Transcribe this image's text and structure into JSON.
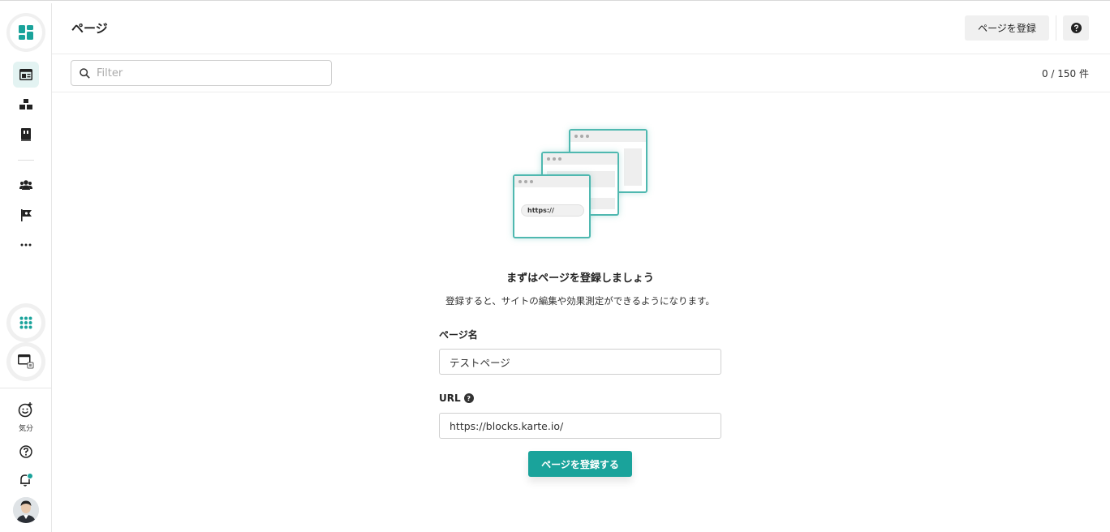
{
  "header": {
    "title": "ページ",
    "register_button": "ページを登録",
    "help_icon": "question-circle-icon"
  },
  "filter": {
    "placeholder": "Filter",
    "value": "",
    "count": "0 / 150 件"
  },
  "sidebar": {
    "items": [
      {
        "name": "pages",
        "icon": "page-layout-icon",
        "active": true
      },
      {
        "name": "blocks",
        "icon": "blocks-icon",
        "active": false
      },
      {
        "name": "book",
        "icon": "book-icon",
        "active": false
      },
      {
        "name": "users",
        "icon": "users-icon",
        "active": false
      },
      {
        "name": "flag",
        "icon": "flag-icon",
        "active": false
      },
      {
        "name": "more",
        "icon": "more-icon",
        "active": false
      }
    ],
    "mood_label": "気分"
  },
  "illustration": {
    "url_text": "https://"
  },
  "empty_state": {
    "heading": "まずはページを登録しましょう",
    "description": "登録すると、サイトの編集や効果測定ができるようになります。",
    "page_name_label": "ページ名",
    "page_name_value": "テストページ",
    "url_label": "URL",
    "url_value": "https://blocks.karte.io/",
    "submit_label": "ページを登録する"
  },
  "colors": {
    "accent": "#1aa39b",
    "accent_light": "#e3f3f2",
    "illustration_border": "#4fb8b0"
  }
}
